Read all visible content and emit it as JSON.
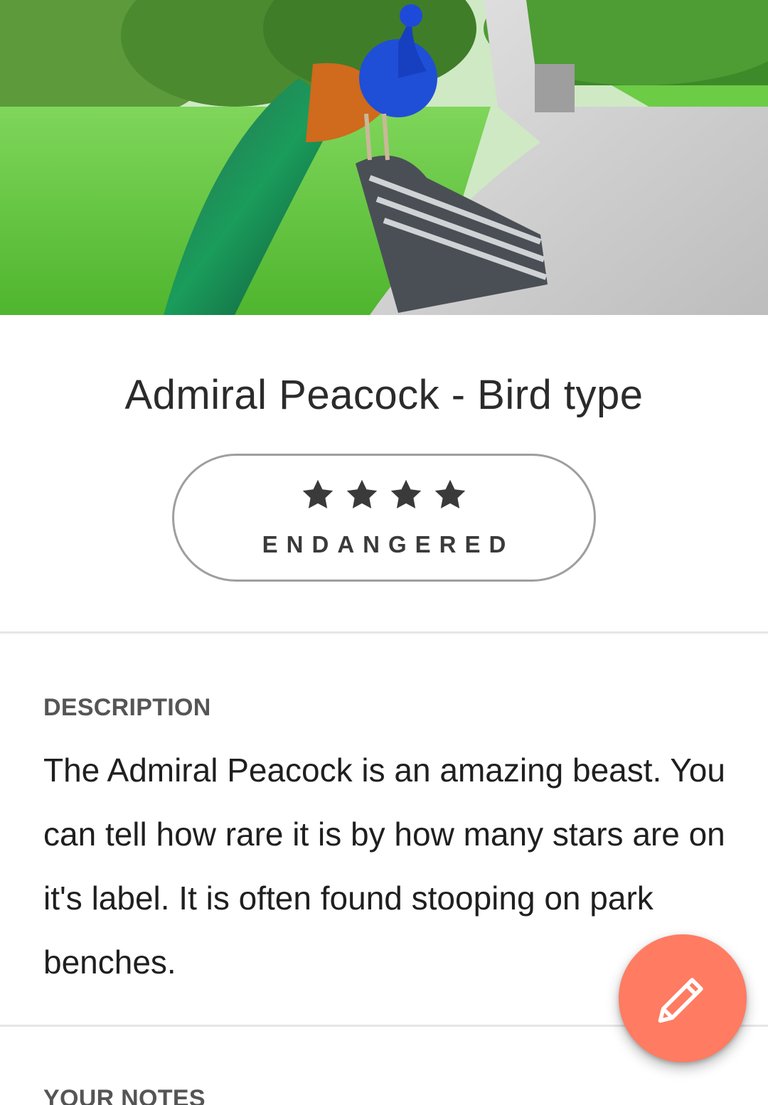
{
  "hero": {
    "image_subject": "peacock perched on park bench"
  },
  "creature": {
    "title": "Admiral Peacock - Bird type",
    "rarity_stars": 4,
    "status": "ENDANGERED"
  },
  "description": {
    "heading": "DESCRIPTION",
    "text": "The Admiral Peacock is an amazing beast. You can tell how rare it is by how many stars are on it's label. It is often found stooping on park benches."
  },
  "notes": {
    "heading": "YOUR NOTES"
  },
  "fab": {
    "icon": "pencil-icon",
    "color": "#ff7b62"
  },
  "colors": {
    "badge_border": "#9e9e9e",
    "star": "#3a3a3a",
    "divider": "#e6e6e6"
  }
}
